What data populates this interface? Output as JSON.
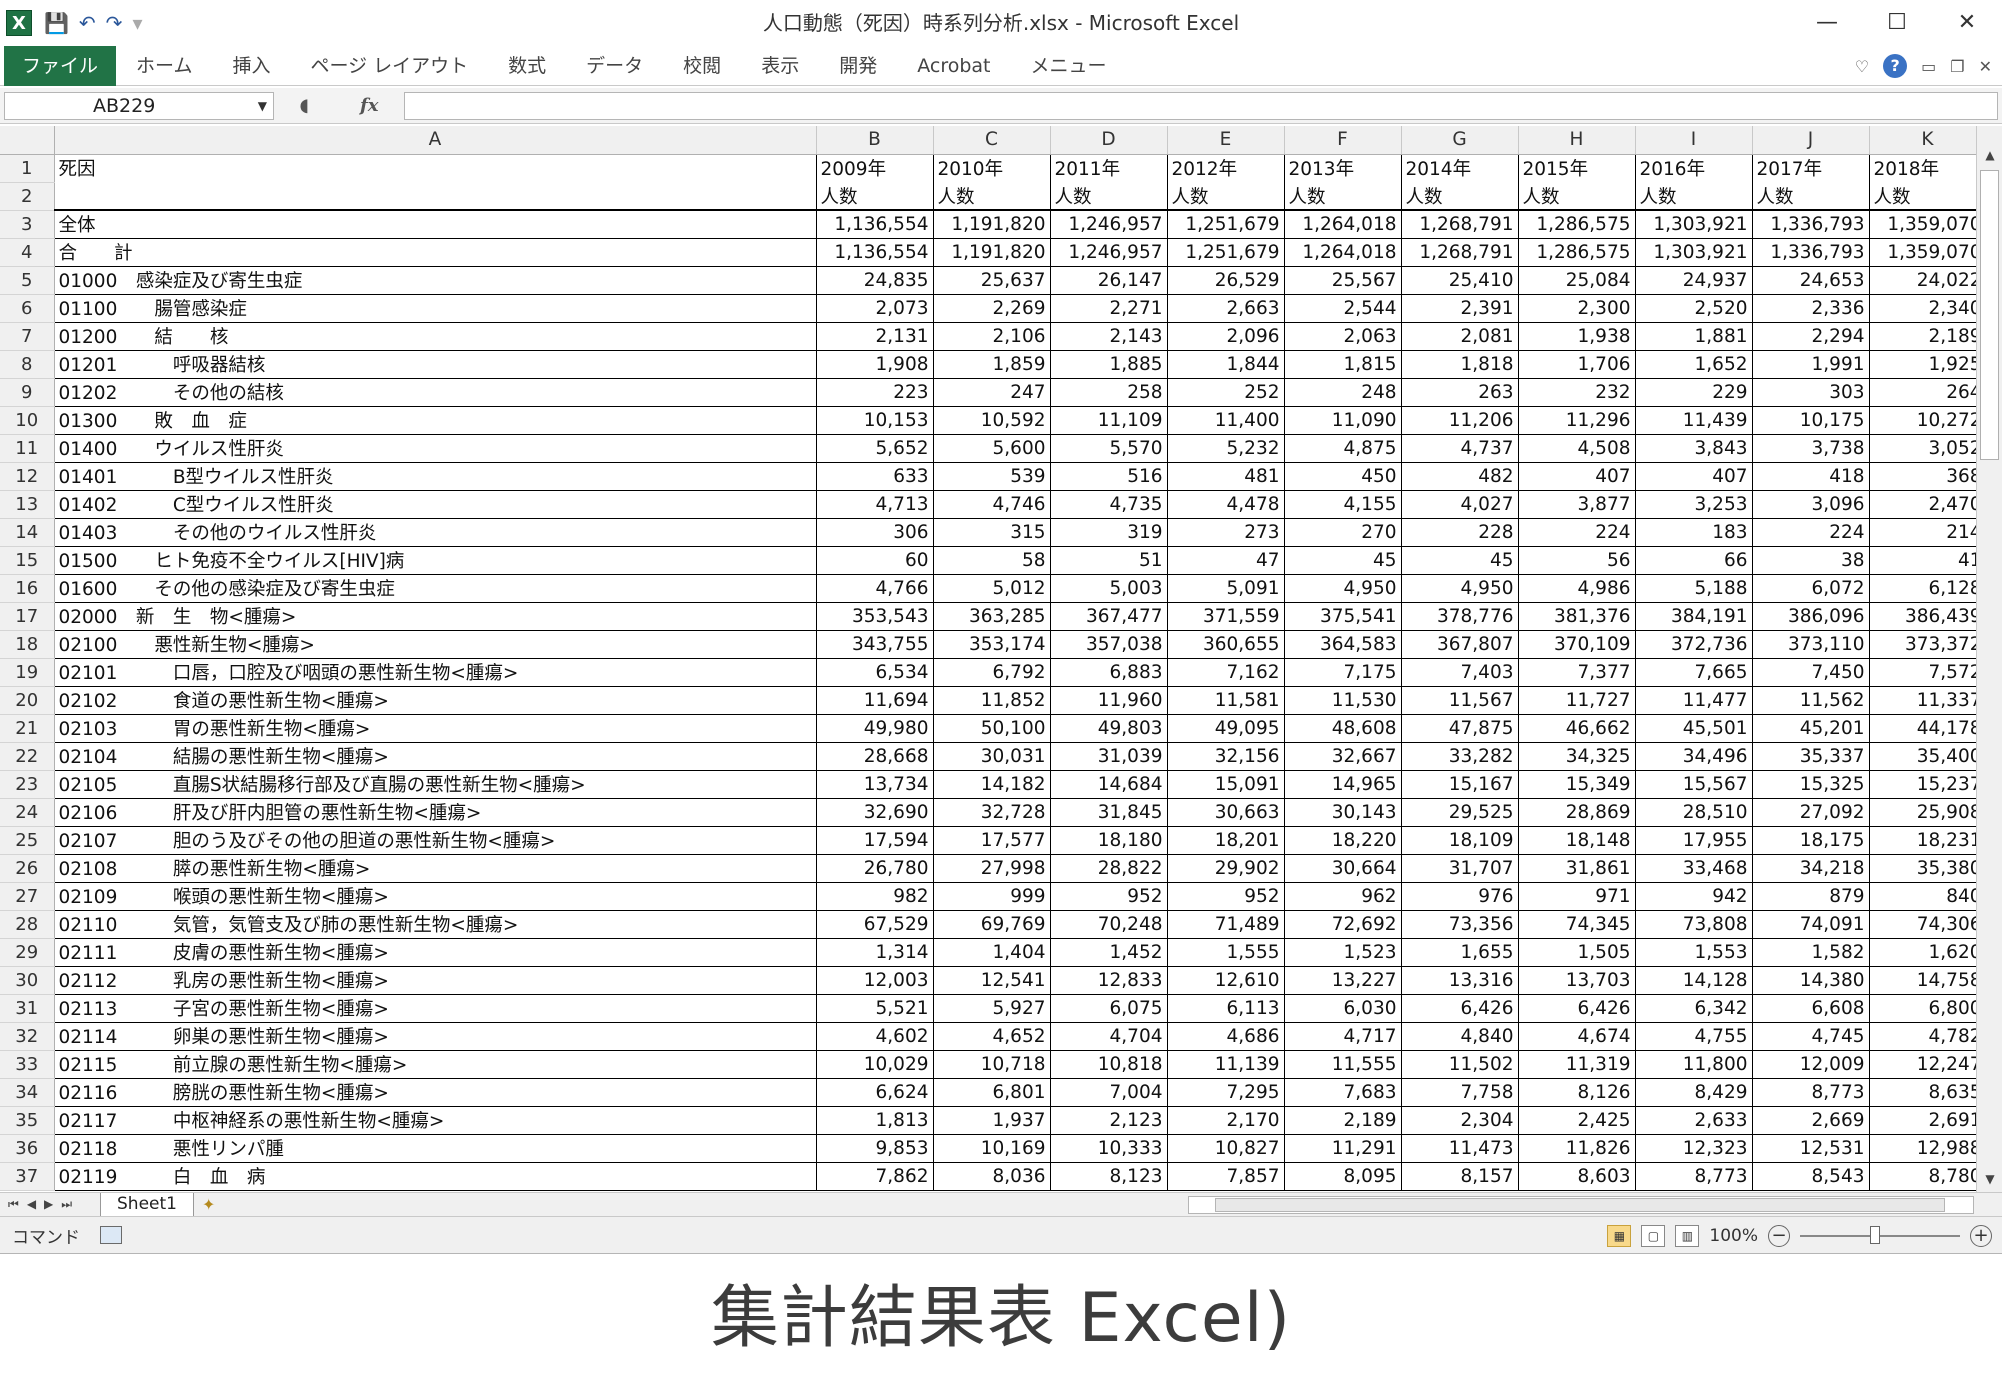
{
  "window": {
    "title": "人口動態（死因）時系列分析.xlsx - Microsoft Excel",
    "app_icon": "X",
    "minimize": "—",
    "maximize": "☐",
    "close": "✕"
  },
  "qat": {
    "save": "💾",
    "undo": "↶",
    "redo": "↷",
    "customize": "▾"
  },
  "ribbon": {
    "tabs": [
      "ファイル",
      "ホーム",
      "挿入",
      "ページ レイアウト",
      "数式",
      "データ",
      "校閲",
      "表示",
      "開発",
      "Acrobat",
      "メニュー"
    ],
    "help": "?"
  },
  "formula_bar": {
    "name_box": "AB229",
    "fx": "fx",
    "formula": ""
  },
  "columns": [
    "A",
    "B",
    "C",
    "D",
    "E",
    "F",
    "G",
    "H",
    "I",
    "J",
    "K"
  ],
  "rows": [
    {
      "n": "1",
      "cells": [
        "死因",
        "2009年",
        "2010年",
        "2011年",
        "2012年",
        "2013年",
        "2014年",
        "2015年",
        "2016年",
        "2017年",
        "2018年"
      ]
    },
    {
      "n": "2",
      "cells": [
        "",
        "人数",
        "人数",
        "人数",
        "人数",
        "人数",
        "人数",
        "人数",
        "人数",
        "人数",
        "人数"
      ]
    },
    {
      "n": "3",
      "cells": [
        "全体",
        "1,136,554",
        "1,191,820",
        "1,246,957",
        "1,251,679",
        "1,264,018",
        "1,268,791",
        "1,286,575",
        "1,303,921",
        "1,336,793",
        "1,359,070"
      ]
    },
    {
      "n": "4",
      "cells": [
        "合　　計",
        "1,136,554",
        "1,191,820",
        "1,246,957",
        "1,251,679",
        "1,264,018",
        "1,268,791",
        "1,286,575",
        "1,303,921",
        "1,336,793",
        "1,359,070"
      ]
    },
    {
      "n": "5",
      "cells": [
        "01000　感染症及び寄生虫症",
        "24,835",
        "25,637",
        "26,147",
        "26,529",
        "25,567",
        "25,410",
        "25,084",
        "24,937",
        "24,653",
        "24,022"
      ]
    },
    {
      "n": "6",
      "cells": [
        "01100　　腸管感染症",
        "2,073",
        "2,269",
        "2,271",
        "2,663",
        "2,544",
        "2,391",
        "2,300",
        "2,520",
        "2,336",
        "2,340"
      ]
    },
    {
      "n": "7",
      "cells": [
        "01200　　結　　核",
        "2,131",
        "2,106",
        "2,143",
        "2,096",
        "2,063",
        "2,081",
        "1,938",
        "1,881",
        "2,294",
        "2,189"
      ]
    },
    {
      "n": "8",
      "cells": [
        "01201　　　呼吸器結核",
        "1,908",
        "1,859",
        "1,885",
        "1,844",
        "1,815",
        "1,818",
        "1,706",
        "1,652",
        "1,991",
        "1,925"
      ]
    },
    {
      "n": "9",
      "cells": [
        "01202　　　その他の結核",
        "223",
        "247",
        "258",
        "252",
        "248",
        "263",
        "232",
        "229",
        "303",
        "264"
      ]
    },
    {
      "n": "10",
      "cells": [
        "01300　　敗　血　症",
        "10,153",
        "10,592",
        "11,109",
        "11,400",
        "11,090",
        "11,206",
        "11,296",
        "11,439",
        "10,175",
        "10,272"
      ]
    },
    {
      "n": "11",
      "cells": [
        "01400　　ウイルス性肝炎",
        "5,652",
        "5,600",
        "5,570",
        "5,232",
        "4,875",
        "4,737",
        "4,508",
        "3,843",
        "3,738",
        "3,052"
      ]
    },
    {
      "n": "12",
      "cells": [
        "01401　　　B型ウイルス性肝炎",
        "633",
        "539",
        "516",
        "481",
        "450",
        "482",
        "407",
        "407",
        "418",
        "368"
      ]
    },
    {
      "n": "13",
      "cells": [
        "01402　　　C型ウイルス性肝炎",
        "4,713",
        "4,746",
        "4,735",
        "4,478",
        "4,155",
        "4,027",
        "3,877",
        "3,253",
        "3,096",
        "2,470"
      ]
    },
    {
      "n": "14",
      "cells": [
        "01403　　　その他のウイルス性肝炎",
        "306",
        "315",
        "319",
        "273",
        "270",
        "228",
        "224",
        "183",
        "224",
        "214"
      ]
    },
    {
      "n": "15",
      "cells": [
        "01500　　ヒト免疫不全ウイルス[HIV]病",
        "60",
        "58",
        "51",
        "47",
        "45",
        "45",
        "56",
        "66",
        "38",
        "41"
      ]
    },
    {
      "n": "16",
      "cells": [
        "01600　　その他の感染症及び寄生虫症",
        "4,766",
        "5,012",
        "5,003",
        "5,091",
        "4,950",
        "4,950",
        "4,986",
        "5,188",
        "6,072",
        "6,128"
      ]
    },
    {
      "n": "17",
      "cells": [
        "02000　新　生　物<腫瘍>",
        "353,543",
        "363,285",
        "367,477",
        "371,559",
        "375,541",
        "378,776",
        "381,376",
        "384,191",
        "386,096",
        "386,439"
      ]
    },
    {
      "n": "18",
      "cells": [
        "02100　　悪性新生物<腫瘍>",
        "343,755",
        "353,174",
        "357,038",
        "360,655",
        "364,583",
        "367,807",
        "370,109",
        "372,736",
        "373,110",
        "373,372"
      ]
    },
    {
      "n": "19",
      "cells": [
        "02101　　　口唇，口腔及び咽頭の悪性新生物<腫瘍>",
        "6,534",
        "6,792",
        "6,883",
        "7,162",
        "7,175",
        "7,403",
        "7,377",
        "7,665",
        "7,450",
        "7,572"
      ]
    },
    {
      "n": "20",
      "cells": [
        "02102　　　食道の悪性新生物<腫瘍>",
        "11,694",
        "11,852",
        "11,960",
        "11,581",
        "11,530",
        "11,567",
        "11,727",
        "11,477",
        "11,562",
        "11,337"
      ]
    },
    {
      "n": "21",
      "cells": [
        "02103　　　胃の悪性新生物<腫瘍>",
        "49,980",
        "50,100",
        "49,803",
        "49,095",
        "48,608",
        "47,875",
        "46,662",
        "45,501",
        "45,201",
        "44,178"
      ]
    },
    {
      "n": "22",
      "cells": [
        "02104　　　結腸の悪性新生物<腫瘍>",
        "28,668",
        "30,031",
        "31,039",
        "32,156",
        "32,667",
        "33,282",
        "34,325",
        "34,496",
        "35,337",
        "35,400"
      ]
    },
    {
      "n": "23",
      "cells": [
        "02105　　　直腸S状結腸移行部及び直腸の悪性新生物<腫瘍>",
        "13,734",
        "14,182",
        "14,684",
        "15,091",
        "14,965",
        "15,167",
        "15,349",
        "15,567",
        "15,325",
        "15,237"
      ]
    },
    {
      "n": "24",
      "cells": [
        "02106　　　肝及び肝内胆管の悪性新生物<腫瘍>",
        "32,690",
        "32,728",
        "31,845",
        "30,663",
        "30,143",
        "29,525",
        "28,869",
        "28,510",
        "27,092",
        "25,908"
      ]
    },
    {
      "n": "25",
      "cells": [
        "02107　　　胆のう及びその他の胆道の悪性新生物<腫瘍>",
        "17,594",
        "17,577",
        "18,180",
        "18,201",
        "18,220",
        "18,109",
        "18,148",
        "17,955",
        "18,175",
        "18,231"
      ]
    },
    {
      "n": "26",
      "cells": [
        "02108　　　膵の悪性新生物<腫瘍>",
        "26,780",
        "27,998",
        "28,822",
        "29,902",
        "30,664",
        "31,707",
        "31,861",
        "33,468",
        "34,218",
        "35,380"
      ]
    },
    {
      "n": "27",
      "cells": [
        "02109　　　喉頭の悪性新生物<腫瘍>",
        "982",
        "999",
        "952",
        "952",
        "962",
        "976",
        "971",
        "942",
        "879",
        "840"
      ]
    },
    {
      "n": "28",
      "cells": [
        "02110　　　気管，気管支及び肺の悪性新生物<腫瘍>",
        "67,529",
        "69,769",
        "70,248",
        "71,489",
        "72,692",
        "73,356",
        "74,345",
        "73,808",
        "74,091",
        "74,306"
      ]
    },
    {
      "n": "29",
      "cells": [
        "02111　　　皮膚の悪性新生物<腫瘍>",
        "1,314",
        "1,404",
        "1,452",
        "1,555",
        "1,523",
        "1,655",
        "1,505",
        "1,553",
        "1,582",
        "1,620"
      ]
    },
    {
      "n": "30",
      "cells": [
        "02112　　　乳房の悪性新生物<腫瘍>",
        "12,003",
        "12,541",
        "12,833",
        "12,610",
        "13,227",
        "13,316",
        "13,703",
        "14,128",
        "14,380",
        "14,758"
      ]
    },
    {
      "n": "31",
      "cells": [
        "02113　　　子宮の悪性新生物<腫瘍>",
        "5,521",
        "5,927",
        "6,075",
        "6,113",
        "6,030",
        "6,426",
        "6,426",
        "6,342",
        "6,608",
        "6,800"
      ]
    },
    {
      "n": "32",
      "cells": [
        "02114　　　卵巣の悪性新生物<腫瘍>",
        "4,602",
        "4,652",
        "4,704",
        "4,686",
        "4,717",
        "4,840",
        "4,674",
        "4,755",
        "4,745",
        "4,782"
      ]
    },
    {
      "n": "33",
      "cells": [
        "02115　　　前立腺の悪性新生物<腫瘍>",
        "10,029",
        "10,718",
        "10,818",
        "11,139",
        "11,555",
        "11,502",
        "11,319",
        "11,800",
        "12,009",
        "12,247"
      ]
    },
    {
      "n": "34",
      "cells": [
        "02116　　　膀胱の悪性新生物<腫瘍>",
        "6,624",
        "6,801",
        "7,004",
        "7,295",
        "7,683",
        "7,758",
        "8,126",
        "8,429",
        "8,773",
        "8,635"
      ]
    },
    {
      "n": "35",
      "cells": [
        "02117　　　中枢神経系の悪性新生物<腫瘍>",
        "1,813",
        "1,937",
        "2,123",
        "2,170",
        "2,189",
        "2,304",
        "2,425",
        "2,633",
        "2,669",
        "2,691"
      ]
    },
    {
      "n": "36",
      "cells": [
        "02118　　　悪性リンパ腫",
        "9,853",
        "10,169",
        "10,333",
        "10,827",
        "11,291",
        "11,473",
        "11,826",
        "12,323",
        "12,531",
        "12,988"
      ]
    },
    {
      "n": "37",
      "cells": [
        "02119　　　白　血　病",
        "7,862",
        "8,036",
        "8,123",
        "7,857",
        "8,095",
        "8,157",
        "8,603",
        "8,773",
        "8,543",
        "8,780"
      ]
    }
  ],
  "sheets": [
    "Sheet1"
  ],
  "sheet_nav": [
    "⏮",
    "◀",
    "▶",
    "⏭"
  ],
  "status": {
    "mode": "コマンド",
    "zoom": "100%",
    "zoom_minus": "−",
    "zoom_plus": "+"
  },
  "caption": "集計結果表 Excel)"
}
